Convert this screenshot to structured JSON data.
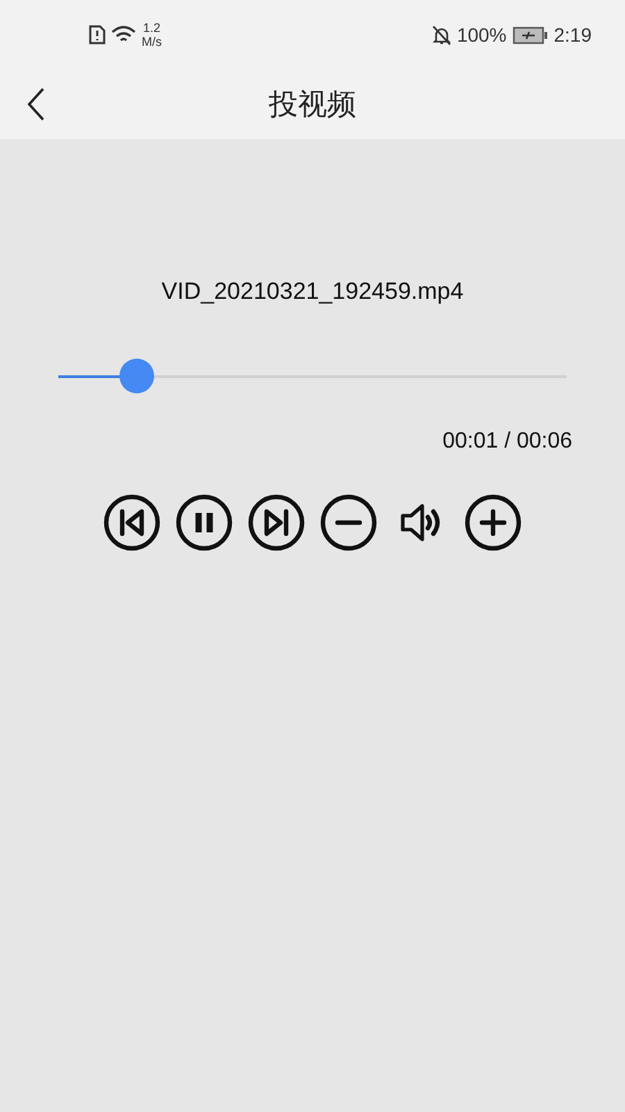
{
  "status_bar": {
    "speed_value": "1.2",
    "speed_unit": "M/s",
    "battery": "100%",
    "time": "2:19"
  },
  "header": {
    "title": "投视频"
  },
  "player": {
    "file_name": "VID_20210321_192459.mp4",
    "progress": {
      "level": 0.153
    },
    "time": "00:01 / 00:06",
    "controls": [
      {
        "kind": "previous"
      },
      {
        "kind": "pause"
      },
      {
        "kind": "next"
      },
      {
        "kind": "volume_down"
      },
      {
        "kind": "volume"
      },
      {
        "kind": "volume_up"
      }
    ]
  }
}
